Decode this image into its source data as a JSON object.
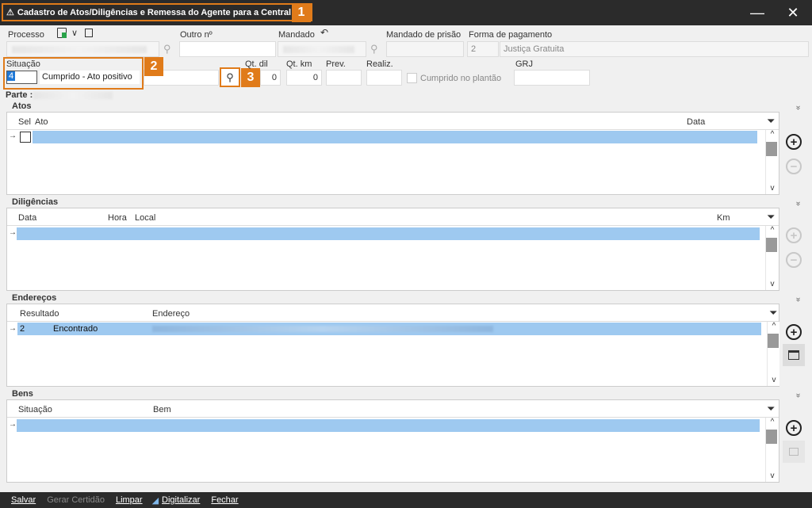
{
  "window": {
    "title": "Cadastro de Atos/Diligências e Remessa do Agente para a Central",
    "minimize": "—",
    "close": "✕"
  },
  "badges": {
    "b1": "1",
    "b2": "2",
    "b3": "3"
  },
  "form": {
    "processo_label": "Processo",
    "outro_label": "Outro nº",
    "mandado_label": "Mandado",
    "mandado_prisao_label": "Mandado de prisão",
    "forma_pagamento_label": "Forma de pagamento",
    "forma_pagamento_code": "2",
    "forma_pagamento_value": "Justiça Gratuita",
    "situacao_label": "Situação",
    "situacao_code": "4",
    "situacao_value": "Cumprido - Ato positivo",
    "qt_dil_label": "Qt. dil",
    "qt_dil_value": "0",
    "qt_km_label": "Qt. km",
    "qt_km_value": "0",
    "prev_label": "Prev.",
    "realiz_label": "Realiz.",
    "cumprido_plantao_label": "Cumprido no plantão",
    "grj_label": "GRJ",
    "parte_label": "Parte :"
  },
  "atos": {
    "title": "Atos",
    "columns": {
      "sel": "Sel",
      "ato": "Ato",
      "data": "Data"
    }
  },
  "diligencias": {
    "title": "Diligências",
    "columns": {
      "data": "Data",
      "hora": "Hora",
      "local": "Local",
      "km": "Km"
    }
  },
  "enderecos": {
    "title": "Endereços",
    "columns": {
      "resultado": "Resultado",
      "endereco": "Endereço"
    },
    "rows": [
      {
        "code": "2",
        "status": "Encontrado"
      }
    ]
  },
  "bens": {
    "title": "Bens",
    "columns": {
      "situacao": "Situação",
      "bem": "Bem"
    }
  },
  "footer": {
    "salvar": "Salvar",
    "gerar_certidao": "Gerar Certidão",
    "limpar": "Limpar",
    "digitalizar": "Digitalizar",
    "fechar": "Fechar"
  },
  "colors": {
    "accent": "#e07b1a",
    "selection": "#9ec9f0",
    "titlebar": "#2b2b2b"
  }
}
